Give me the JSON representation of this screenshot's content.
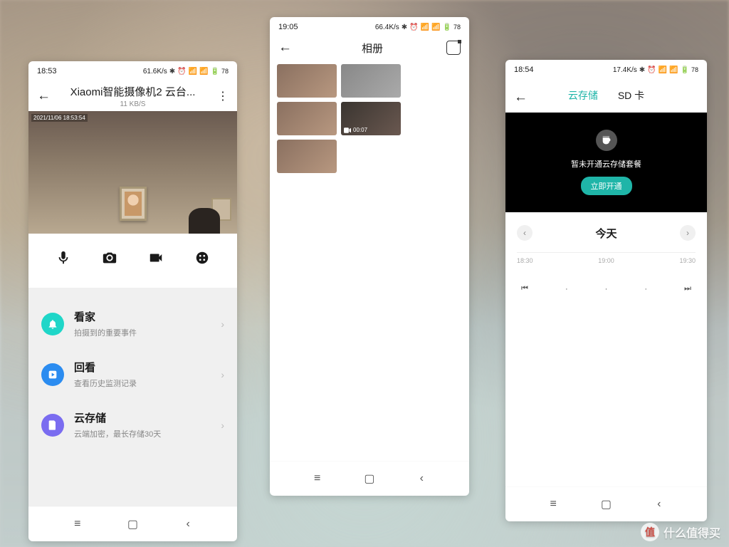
{
  "watermark": "什么值得买",
  "phone1": {
    "time": "18:53",
    "net": "61.6K/s",
    "battery": "78",
    "title": "Xiaomi智能摄像机2 云台...",
    "bitrate": "11 KB/S",
    "timestamp": "2021/11/06 18:53:54",
    "menu": [
      {
        "title": "看家",
        "sub": "拍摄到的重要事件",
        "color": "#1fd6c8",
        "icon": "bell"
      },
      {
        "title": "回看",
        "sub": "查看历史监测记录",
        "color": "#2b8cf0",
        "icon": "play"
      },
      {
        "title": "云存储",
        "sub": "云端加密，最长存储30天",
        "color": "#7a6cf0",
        "icon": "doc"
      }
    ]
  },
  "phone2": {
    "time": "19:05",
    "net": "66.4K/s",
    "battery": "78",
    "title": "相册",
    "video_duration": "00:07"
  },
  "phone3": {
    "time": "18:54",
    "net": "17.4K/s",
    "battery": "78",
    "tabs": {
      "cloud": "云存储",
      "sd": "SD 卡"
    },
    "promo_msg": "暂未开通云存储套餐",
    "promo_btn": "立即开通",
    "date": "今天",
    "ticks": [
      "18:30",
      "19:00",
      "19:30"
    ]
  }
}
